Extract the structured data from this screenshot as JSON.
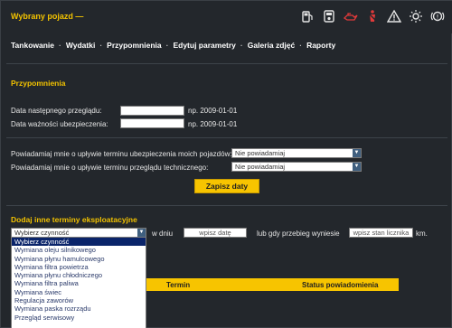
{
  "header": {
    "vehicle_title": "Wybrany pojazd —",
    "indicators": [
      "fuel-pump-icon",
      "car-wash-icon",
      "oil-can-icon",
      "seatbelt-icon",
      "warning-triangle-icon",
      "lights-icon",
      "brake-icon"
    ],
    "indicator_colors": {
      "normal": "#e6e6e6",
      "alert": "#e03a3a"
    }
  },
  "nav": {
    "items": [
      "Tankowanie",
      "Wydatki",
      "Przypomnienia",
      "Edytuj parametry",
      "Galeria zdjęć",
      "Raporty"
    ]
  },
  "reminders": {
    "title": "Przypomnienia",
    "next_inspection_label": "Data następnego przeglądu:",
    "next_inspection_value": "",
    "next_inspection_hint": "np. 2009-01-01",
    "insurance_label": "Data ważności ubezpieczenia:",
    "insurance_value": "",
    "insurance_hint": "np. 2009-01-01",
    "notify_insurance_label": "Powiadamiaj mnie o upływie terminu ubezpieczenia moich pojazdów:",
    "notify_insurance_value": "Nie powiadamiaj",
    "notify_inspection_label": "Powiadamiaj mnie o upływie terminu przeglądu technicznego:",
    "notify_inspection_value": "Nie powiadamiaj",
    "save_button": "Zapisz daty"
  },
  "add_terms": {
    "title": "Dodaj inne terminy eksploatacyjne",
    "activity_select_value": "Wybierz czynność",
    "on_day_label": "w dniu",
    "date_placeholder": "wpisz datę",
    "or_mileage_label": "lub gdy przebieg wyniesie",
    "mileage_placeholder": "wpisz stan licznika",
    "unit": "km.",
    "options": [
      "Wybierz czynność",
      "Wymiana oleju silnikowego",
      "Wymiana płynu hamulcowego",
      "Wymiana filtra powietrza",
      "Wymiana płynu chłodniczego",
      "Wymiana filtra paliwa",
      "Wymiana świec",
      "Regulacja zaworów",
      "Wymiana paska rozrządu",
      "Przegląd serwisowy"
    ],
    "highlighted_option_index": 0
  },
  "table": {
    "columns": [
      "Termin",
      "Status powiadomienia"
    ]
  },
  "colors": {
    "accent": "#f7c400",
    "background": "#23272c",
    "selected_option": "#0a246a"
  }
}
